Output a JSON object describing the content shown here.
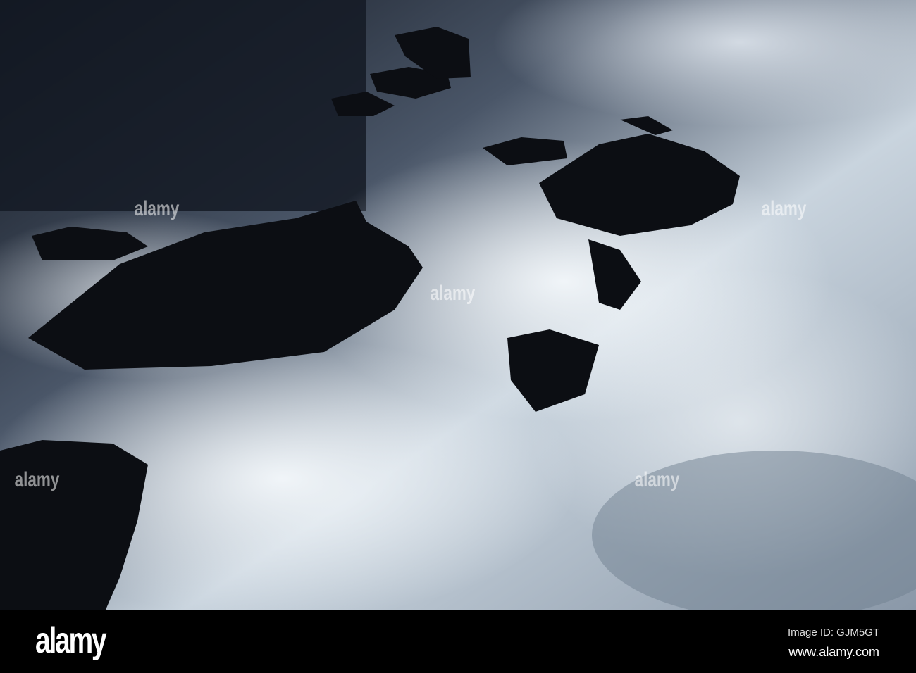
{
  "photo": {
    "subject": "rushing-water-over-rocks",
    "palette": {
      "water": "#e6eef3",
      "shadow": "#1c2430",
      "rock": "#0d0f14"
    }
  },
  "watermark": {
    "text": "alamy"
  },
  "footer": {
    "logo": "alamy",
    "image_id": "Image ID: GJM5GT",
    "website": "www.alamy.com"
  }
}
